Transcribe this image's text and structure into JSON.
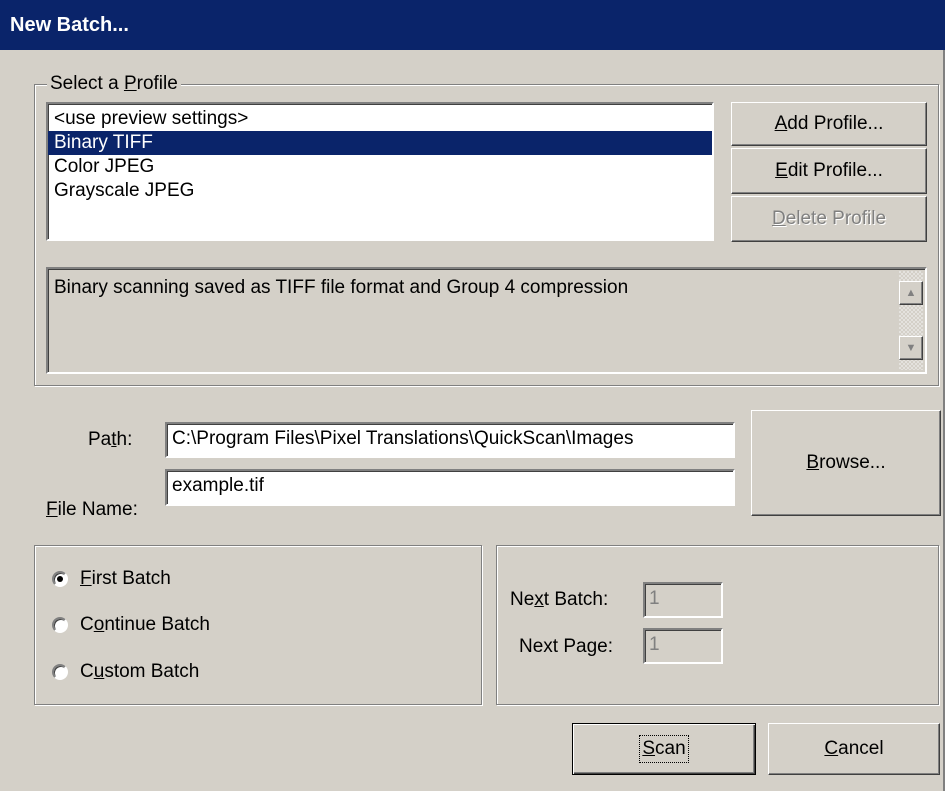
{
  "window": {
    "title": "New Batch..."
  },
  "profile_group": {
    "legend_pre": "Select a ",
    "legend_key": "P",
    "legend_post": "rofile",
    "items": [
      "<use preview settings>",
      "Binary TIFF",
      "Color JPEG",
      "Grayscale JPEG"
    ],
    "selected_index": 1,
    "description": "Binary scanning saved as TIFF file format and Group 4 compression"
  },
  "buttons": {
    "add_profile": {
      "key": "A",
      "rest": "dd Profile..."
    },
    "edit_profile": {
      "key": "E",
      "rest": "dit Profile..."
    },
    "delete_profile": {
      "key": "D",
      "rest": "elete Profile",
      "enabled": false
    },
    "browse": {
      "key": "B",
      "rest": "rowse..."
    },
    "scan": {
      "key": "S",
      "rest": "can"
    },
    "cancel": {
      "key": "C",
      "rest": "ancel"
    }
  },
  "path_field": {
    "label_pre": "Pa",
    "label_key": "t",
    "label_post": "h:",
    "value": "C:\\Program Files\\Pixel Translations\\QuickScan\\Images"
  },
  "filename_field": {
    "label_key": "F",
    "label_post": "ile Name:",
    "value": "example.tif"
  },
  "batch_options": [
    {
      "key": "F",
      "rest": "irst Batch",
      "checked": true
    },
    {
      "pre": "C",
      "key": "o",
      "rest": "ntinue Batch",
      "checked": false
    },
    {
      "pre": "C",
      "key": "u",
      "rest": "stom Batch",
      "checked": false
    }
  ],
  "next_batch": {
    "label_pre": "Ne",
    "label_key": "x",
    "label_post": "t Batch:",
    "value": "1"
  },
  "next_page": {
    "label": "Next Page:",
    "value": "1"
  },
  "scrollbar": {
    "up_icon": "triangle-up",
    "down_icon": "triangle-down"
  }
}
